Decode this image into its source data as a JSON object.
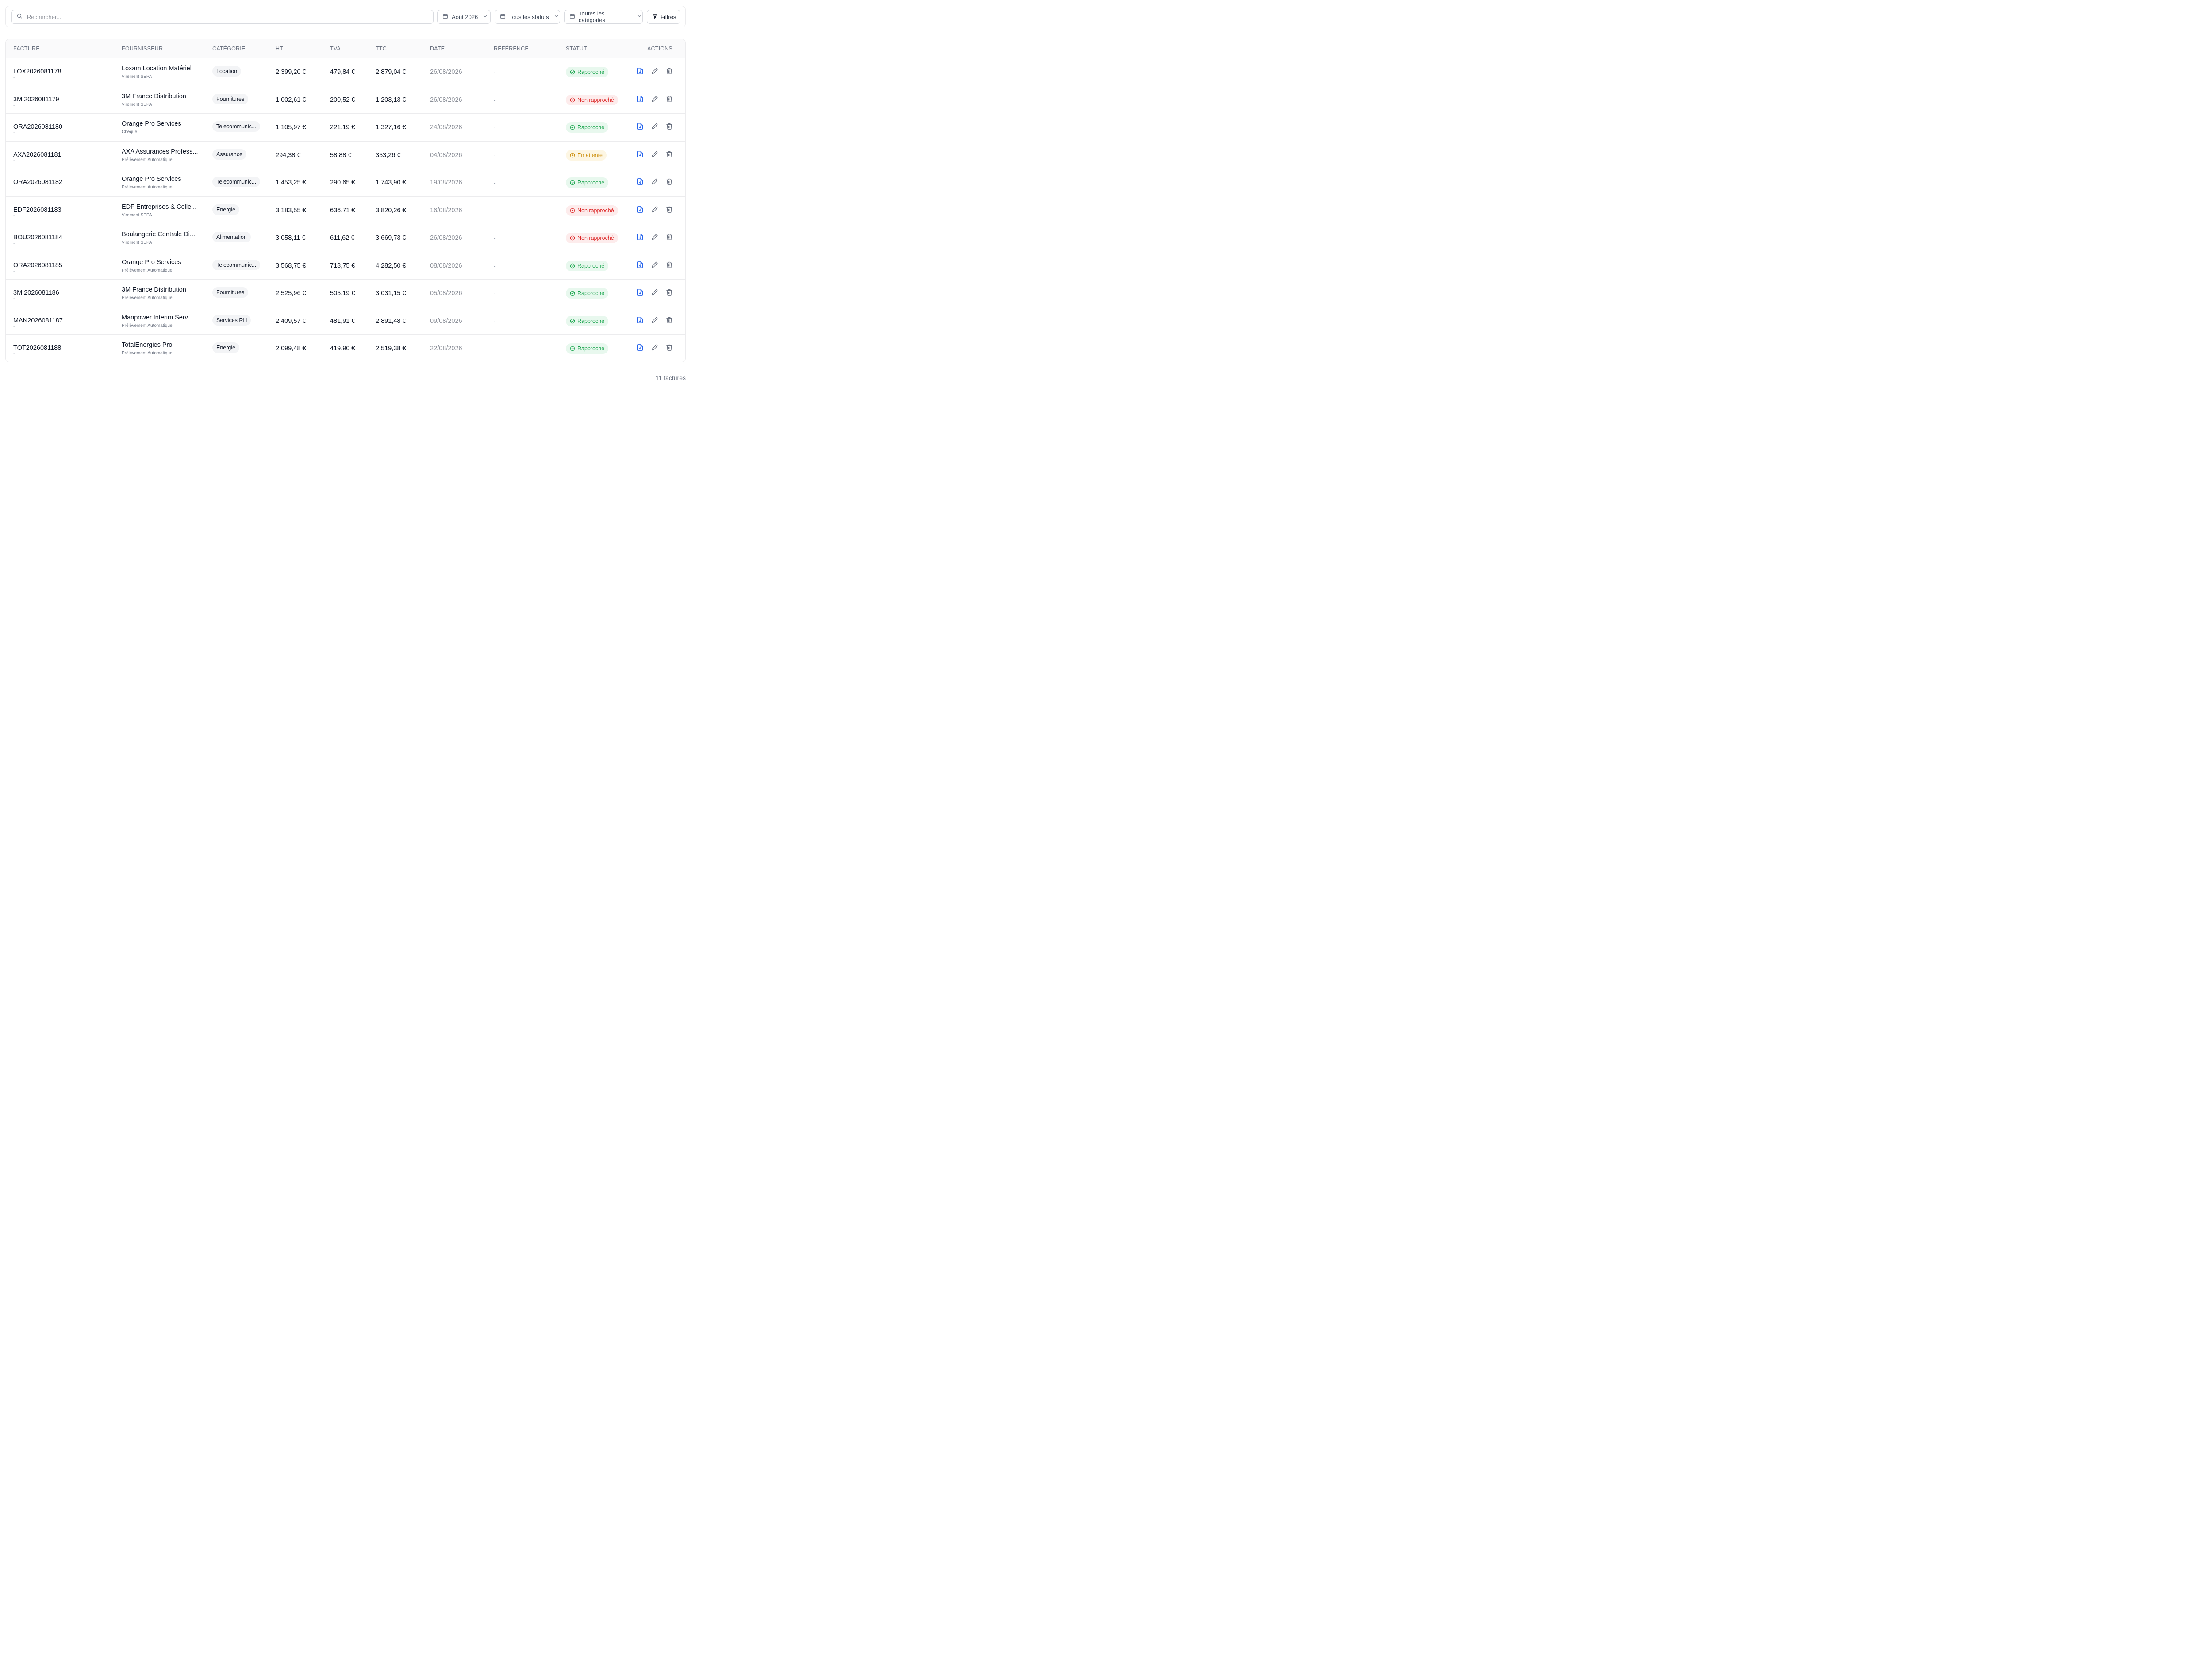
{
  "toolbar": {
    "search_placeholder": "Rechercher...",
    "month": "Août 2026",
    "status": "Tous les statuts",
    "category": "Toutes les catégories",
    "filters_label": "Filtres"
  },
  "columns": [
    "FACTURE",
    "FOURNISSEUR",
    "CATÉGORIE",
    "HT",
    "TVA",
    "TTC",
    "DATE",
    "RÉFÉRENCE",
    "STATUT",
    "ACTIONS"
  ],
  "status_styles": {
    "Rapproché": {
      "bg": "#e8f8ee",
      "fg": "#16a34a",
      "icon": "check-circle-icon"
    },
    "Non rapproché": {
      "bg": "#fdecec",
      "fg": "#dc2626",
      "icon": "x-circle-icon"
    },
    "En attente": {
      "bg": "#fdf6e3",
      "fg": "#ca8a04",
      "icon": "clock-icon"
    }
  },
  "colors": {
    "action_blue": "#2563eb",
    "action_gray": "#6b7280"
  },
  "invoices": [
    {
      "number": "LOX2026081178",
      "number_sub": "-",
      "supplier": "Loxam Location Matériel",
      "payment": "Virement SEPA",
      "category": "Location",
      "ht": "2 399,20 €",
      "tva": "479,84 €",
      "ttc": "2 879,04 €",
      "date": "26/08/2026",
      "reference": "-",
      "status": "Rapproché"
    },
    {
      "number": "3M 2026081179",
      "number_sub": "-",
      "supplier": "3M France Distribution",
      "payment": "Virement SEPA",
      "category": "Fournitures",
      "ht": "1 002,61 €",
      "tva": "200,52 €",
      "ttc": "1 203,13 €",
      "date": "26/08/2026",
      "reference": "-",
      "status": "Non rapproché"
    },
    {
      "number": "ORA2026081180",
      "number_sub": "-",
      "supplier": "Orange Pro Services",
      "payment": "Chèque",
      "category": "Telecommunic...",
      "ht": "1 105,97 €",
      "tva": "221,19 €",
      "ttc": "1 327,16 €",
      "date": "24/08/2026",
      "reference": "-",
      "status": "Rapproché"
    },
    {
      "number": "AXA2026081181",
      "number_sub": "-",
      "supplier": "AXA Assurances Profess...",
      "payment": "Prélèvement Automatique",
      "category": "Assurance",
      "ht": "294,38 €",
      "tva": "58,88 €",
      "ttc": "353,26 €",
      "date": "04/08/2026",
      "reference": "-",
      "status": "En attente"
    },
    {
      "number": "ORA2026081182",
      "number_sub": "-",
      "supplier": "Orange Pro Services",
      "payment": "Prélèvement Automatique",
      "category": "Telecommunic...",
      "ht": "1 453,25 €",
      "tva": "290,65 €",
      "ttc": "1 743,90 €",
      "date": "19/08/2026",
      "reference": "-",
      "status": "Rapproché"
    },
    {
      "number": "EDF2026081183",
      "number_sub": "-",
      "supplier": "EDF Entreprises & Colle...",
      "payment": "Virement SEPA",
      "category": "Energie",
      "ht": "3 183,55 €",
      "tva": "636,71 €",
      "ttc": "3 820,26 €",
      "date": "16/08/2026",
      "reference": "-",
      "status": "Non rapproché"
    },
    {
      "number": "BOU2026081184",
      "number_sub": "-",
      "supplier": "Boulangerie Centrale Di...",
      "payment": "Virement SEPA",
      "category": "Alimentation",
      "ht": "3 058,11 €",
      "tva": "611,62 €",
      "ttc": "3 669,73 €",
      "date": "26/08/2026",
      "reference": "-",
      "status": "Non rapproché"
    },
    {
      "number": "ORA2026081185",
      "number_sub": "-",
      "supplier": "Orange Pro Services",
      "payment": "Prélèvement Automatique",
      "category": "Telecommunic...",
      "ht": "3 568,75 €",
      "tva": "713,75 €",
      "ttc": "4 282,50 €",
      "date": "08/08/2026",
      "reference": "-",
      "status": "Rapproché"
    },
    {
      "number": "3M 2026081186",
      "number_sub": "-",
      "supplier": "3M France Distribution",
      "payment": "Prélèvement Automatique",
      "category": "Fournitures",
      "ht": "2 525,96 €",
      "tva": "505,19 €",
      "ttc": "3 031,15 €",
      "date": "05/08/2026",
      "reference": "-",
      "status": "Rapproché"
    },
    {
      "number": "MAN2026081187",
      "number_sub": "-",
      "supplier": "Manpower Interim Serv...",
      "payment": "Prélèvement Automatique",
      "category": "Services RH",
      "ht": "2 409,57 €",
      "tva": "481,91 €",
      "ttc": "2 891,48 €",
      "date": "09/08/2026",
      "reference": "-",
      "status": "Rapproché"
    },
    {
      "number": "TOT2026081188",
      "number_sub": "-",
      "supplier": "TotalEnergies Pro",
      "payment": "Prélèvement Automatique",
      "category": "Energie",
      "ht": "2 099,48 €",
      "tva": "419,90 €",
      "ttc": "2 519,38 €",
      "date": "22/08/2026",
      "reference": "-",
      "status": "Rapproché"
    }
  ],
  "footer": {
    "count": "11 factures"
  }
}
